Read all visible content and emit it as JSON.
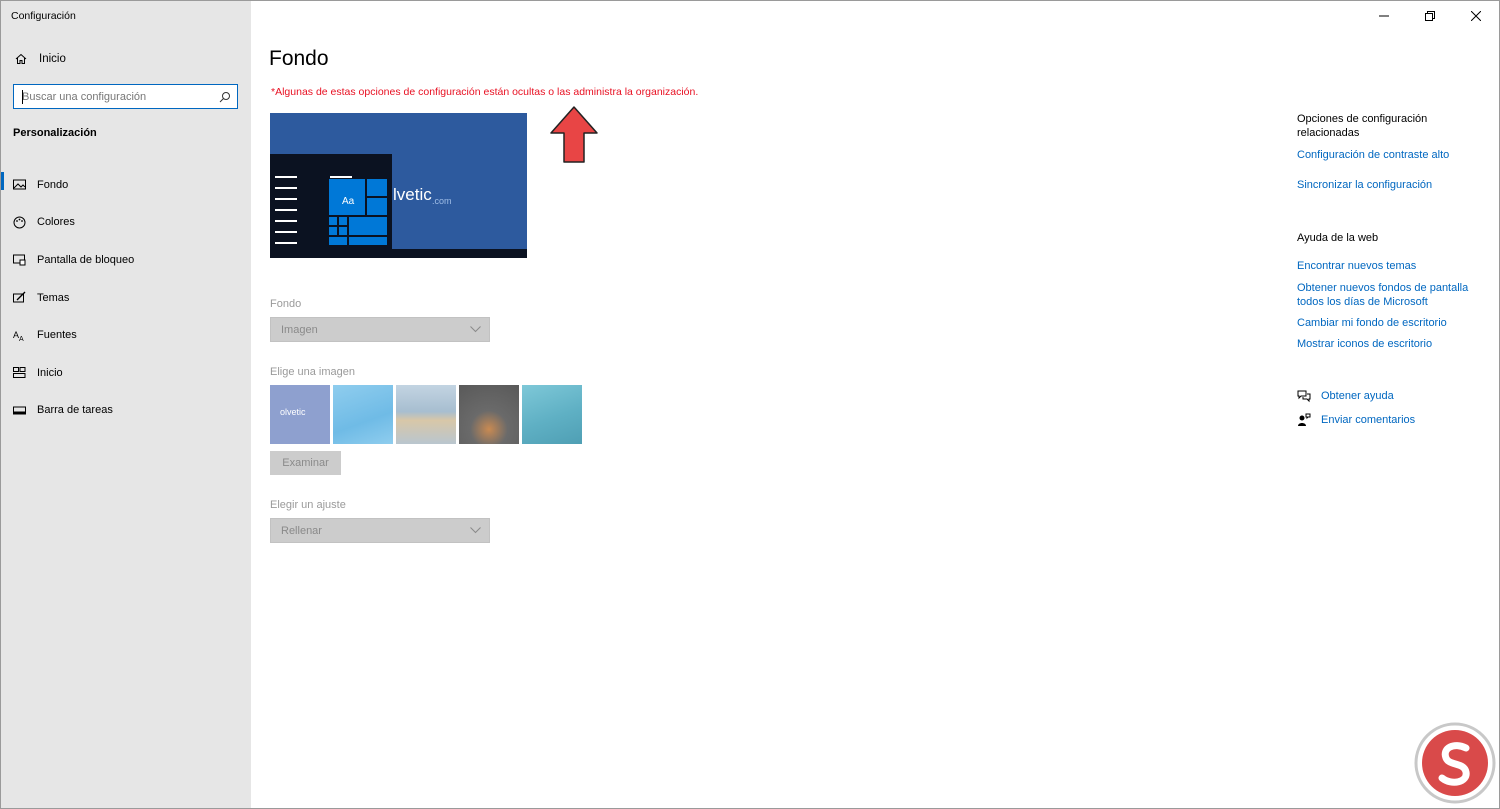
{
  "window": {
    "title": "Configuración"
  },
  "sidebar": {
    "home_label": "Inicio",
    "search_placeholder": "Buscar una configuración",
    "section_title": "Personalización",
    "items": [
      {
        "label": "Fondo",
        "icon": "picture-icon",
        "active": true
      },
      {
        "label": "Colores",
        "icon": "palette-icon",
        "active": false
      },
      {
        "label": "Pantalla de bloqueo",
        "icon": "lock-screen-icon",
        "active": false
      },
      {
        "label": "Temas",
        "icon": "brush-icon",
        "active": false
      },
      {
        "label": "Fuentes",
        "icon": "font-icon",
        "active": false
      },
      {
        "label": "Inicio",
        "icon": "start-icon",
        "active": false
      },
      {
        "label": "Barra de tareas",
        "icon": "taskbar-icon",
        "active": false
      }
    ]
  },
  "main": {
    "title": "Fondo",
    "warning": "*Algunas de estas opciones de configuración están ocultas o las administra la organización.",
    "preview": {
      "aa_label": "Aa",
      "logo_text": "lvetic",
      "logo_sub": ".com"
    },
    "background": {
      "label": "Fondo",
      "value": "Imagen"
    },
    "choose_image": {
      "label": "Elige una imagen",
      "thumb_text": "olvetic",
      "browse_label": "Examinar"
    },
    "fit": {
      "label": "Elegir un ajuste",
      "value": "Rellenar"
    }
  },
  "related": {
    "heading": "Opciones de configuración relacionadas",
    "links": [
      "Configuración de contraste alto",
      "Sincronizar la configuración"
    ],
    "web_heading": "Ayuda de la web",
    "web_links": [
      "Encontrar nuevos temas",
      "Obtener nuevos fondos de pantalla todos los días de Microsoft",
      "Cambiar mi fondo de escritorio",
      "Mostrar iconos de escritorio"
    ],
    "get_help": "Obtener ayuda",
    "feedback": "Enviar comentarios"
  },
  "colors": {
    "accent": "#0067c0",
    "warning": "#e81123",
    "sidebar_bg": "#e6e6e6"
  }
}
